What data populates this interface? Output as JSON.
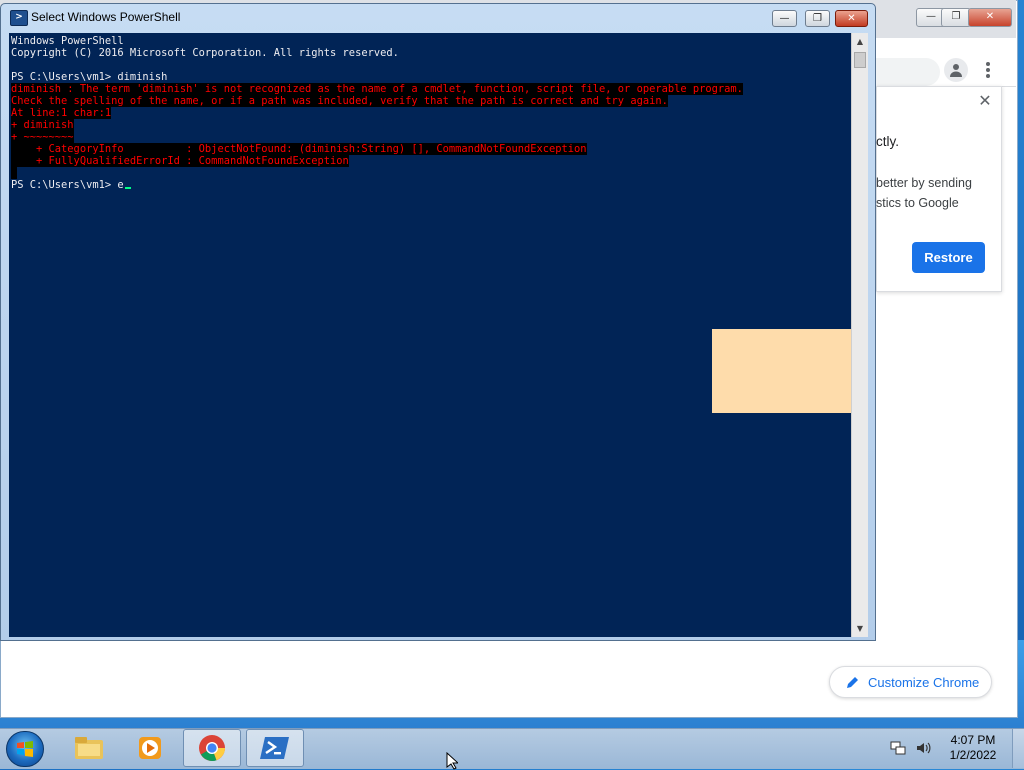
{
  "powershell": {
    "title": "Select Windows PowerShell",
    "lines": [
      {
        "text": "Windows PowerShell",
        "error": false
      },
      {
        "text": "Copyright (C) 2016 Microsoft Corporation. All rights reserved.",
        "error": false
      },
      {
        "text": "",
        "error": false
      },
      {
        "text": "PS C:\\Users\\vm1> diminish",
        "error": false
      },
      {
        "text": "diminish : The term 'diminish' is not recognized as the name of a cmdlet, function, script file, or operable program.",
        "error": true
      },
      {
        "text": "Check the spelling of the name, or if a path was included, verify that the path is correct and try again.",
        "error": true
      },
      {
        "text": "At line:1 char:1",
        "error": true
      },
      {
        "text": "+ diminish",
        "error": true
      },
      {
        "text": "+ ~~~~~~~~",
        "error": true
      },
      {
        "text": "    + CategoryInfo          : ObjectNotFound: (diminish:String) [], CommandNotFoundException",
        "error": true
      },
      {
        "text": "    + FullyQualifiedErrorId : CommandNotFoundException",
        "error": true
      },
      {
        "text": " ",
        "error": true
      },
      {
        "text": "PS C:\\Users\\vm1> e",
        "error": false,
        "cursor": true
      }
    ]
  },
  "chrome": {
    "restore_title": "ctly.",
    "restore_line1": "better by sending",
    "restore_line2": "stics to Google",
    "restore_button": "Restore",
    "customize_label": "Customize Chrome"
  },
  "taskbar": {
    "time": "4:07 PM",
    "date": "1/2/2022",
    "icons": [
      "windows-start-icon",
      "file-explorer-icon",
      "media-player-icon",
      "chrome-icon",
      "powershell-icon",
      "network-icon",
      "volume-icon"
    ]
  },
  "colors": {
    "console_bg": "#012456",
    "console_fg": "#eeedf0",
    "error_fg": "#ff0000",
    "error_bg": "#000000",
    "accent": "#1a73e8"
  }
}
